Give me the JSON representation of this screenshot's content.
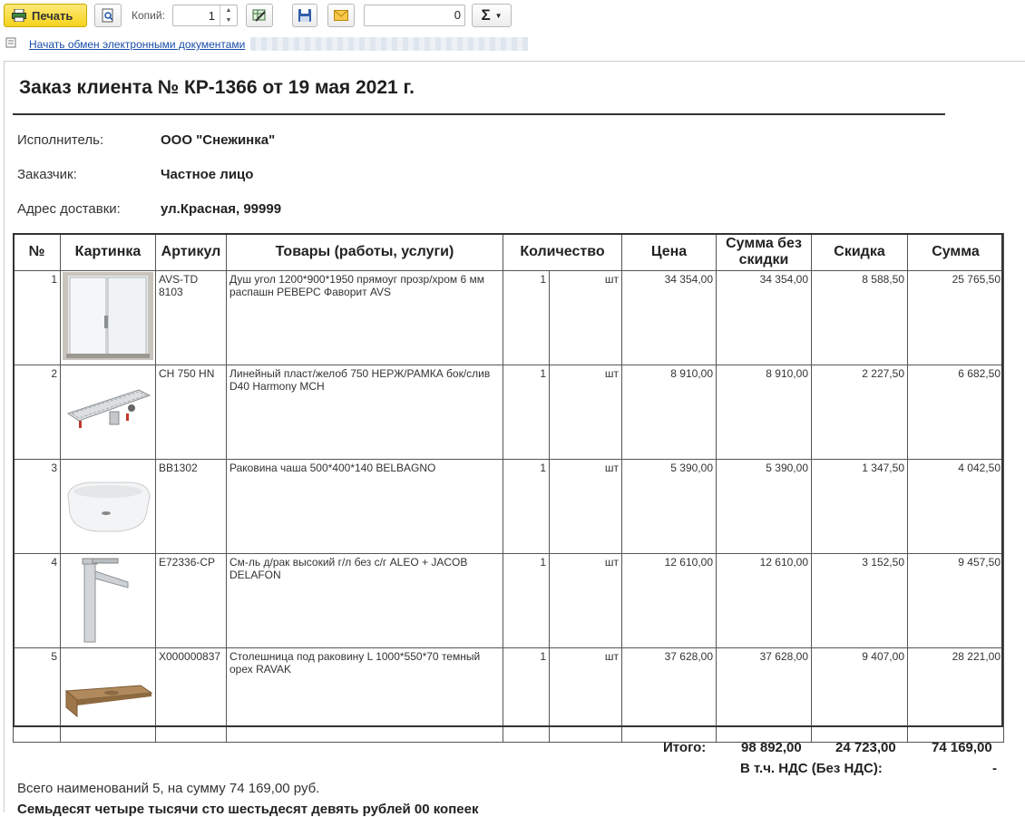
{
  "toolbar": {
    "print_label": "Печать",
    "copies_label": "Копий:",
    "copies_value": "1",
    "sum_value": "0",
    "sum_symbol": "Σ"
  },
  "edo_link": "Начать обмен электронными документами",
  "doc": {
    "title": "Заказ клиента № КР-1366 от 19 мая 2021 г.",
    "fields": [
      {
        "label": "Исполнитель:",
        "value": "ООО \"Снежинка\""
      },
      {
        "label": "Заказчик:",
        "value": "Частное лицо"
      },
      {
        "label": "Адрес доставки:",
        "value": "ул.Красная, 99999"
      }
    ],
    "columns": [
      "№",
      "Картинка",
      "Артикул",
      "Товары (работы, услуги)",
      "Количество",
      "Цена",
      "Сумма без скидки",
      "Скидка",
      "Сумма"
    ],
    "rows": [
      {
        "n": "1",
        "image": "shower-enclosure",
        "sku": "AVS-TD 8103",
        "name": "Душ угол 1200*900*1950 прямоуг прозр/хром 6 мм распашн РЕВЕРС Фаворит AVS",
        "qty": "1",
        "unit": "шт",
        "price": "34 354,00",
        "sum_nodisc": "34 354,00",
        "discount": "8 588,50",
        "sum": "25 765,50"
      },
      {
        "n": "2",
        "image": "linear-drain",
        "sku": "CH 750 HN",
        "name": "Линейный пласт/желоб 750 НЕРЖ/РАМКА бок/слив D40 Harmony MCH",
        "qty": "1",
        "unit": "шт",
        "price": "8 910,00",
        "sum_nodisc": "8 910,00",
        "discount": "2 227,50",
        "sum": "6 682,50"
      },
      {
        "n": "3",
        "image": "vessel-sink",
        "sku": "BB1302",
        "name": "Раковина чаша 500*400*140 BELBAGNO",
        "qty": "1",
        "unit": "шт",
        "price": "5 390,00",
        "sum_nodisc": "5 390,00",
        "discount": "1 347,50",
        "sum": "4 042,50"
      },
      {
        "n": "4",
        "image": "tall-faucet",
        "sku": "E72336-CP",
        "name": "См-ль д/рак высокий г/л без с/г ALEO + JACOB DELAFON",
        "qty": "1",
        "unit": "шт",
        "price": "12 610,00",
        "sum_nodisc": "12 610,00",
        "discount": "3 152,50",
        "sum": "9 457,50"
      },
      {
        "n": "5",
        "image": "wooden-countertop",
        "sku": "X000000837",
        "name": "Столешница под раковину L 1000*550*70 темный орех RAVAK",
        "qty": "1",
        "unit": "шт",
        "price": "37 628,00",
        "sum_nodisc": "37 628,00",
        "discount": "9 407,00",
        "sum": "28 221,00"
      }
    ],
    "totals": {
      "label": "Итого:",
      "sum_nodisc": "98 892,00",
      "discount": "24 723,00",
      "sum": "74 169,00",
      "vat_label": "В т.ч. НДС (Без НДС):",
      "vat_value": "-"
    },
    "summary_line": "Всего наименований 5, на сумму 74 169,00 руб.",
    "amount_words": "Семьдесят четыре тысячи сто шестьдесят девять рублей 00 копеек"
  }
}
